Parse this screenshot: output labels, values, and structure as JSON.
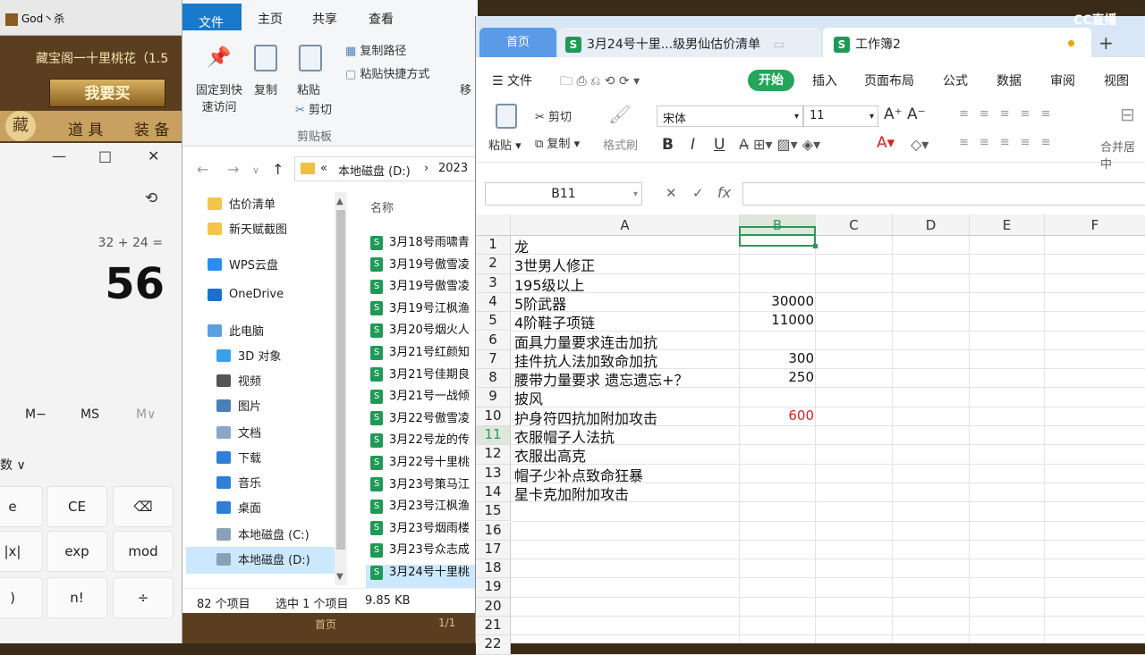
{
  "game": {
    "window_title": "God丶杀",
    "banner": "藏宝阁一十里桃花（1.5",
    "buy_label": "我要买",
    "seal": "藏",
    "tab1": "道 具",
    "tab2": "装 备"
  },
  "calculator": {
    "minimize": "—",
    "maximize": "□",
    "close": "✕",
    "history_icon": "history-icon",
    "expression": "32 + 24 =",
    "result": "56",
    "mem_minus": "M−",
    "mem_store": "MS",
    "mem_list": "M∨",
    "degree_fragment": "数 ∨",
    "rows": [
      [
        "e",
        "CE",
        "⌫"
      ],
      [
        "|x|",
        "exp",
        "mod"
      ],
      [
        ")",
        "n!",
        "÷"
      ]
    ]
  },
  "explorer": {
    "tabs": [
      "文件",
      "主页",
      "共享",
      "查看"
    ],
    "ribbon": {
      "pin": "固定到快\n速访问",
      "copy": "复制",
      "paste": "粘贴",
      "copy_path": "复制路径",
      "paste_shortcut": "粘贴快捷方式",
      "cut": "剪切",
      "group": "剪贴板",
      "move_fragment": "移"
    },
    "address": {
      "prefix": "«",
      "drive": "本地磁盘 (D:)",
      "sep": "›",
      "folder_fragment": "2023"
    },
    "nav": [
      {
        "label": "估价清单",
        "color": "#f3c54c"
      },
      {
        "label": "新天赋截图",
        "color": "#f3c54c"
      },
      {
        "label": "WPS云盘",
        "color": "#2b8cf0"
      },
      {
        "label": "OneDrive",
        "color": "#1f6fd0"
      },
      {
        "label": "此电脑",
        "color": "#5aa0e0"
      },
      {
        "label": "3D 对象",
        "color": "#3aa0e8"
      },
      {
        "label": "视频",
        "color": "#555555"
      },
      {
        "label": "图片",
        "color": "#4a7fb8"
      },
      {
        "label": "文档",
        "color": "#8aa6c8"
      },
      {
        "label": "下载",
        "color": "#2d7fd8"
      },
      {
        "label": "音乐",
        "color": "#2d7fd8"
      },
      {
        "label": "桌面",
        "color": "#2d7fd8"
      },
      {
        "label": "本地磁盘 (C:)",
        "color": "#8aa0b8"
      },
      {
        "label": "本地磁盘 (D:)",
        "color": "#8aa0b8"
      }
    ],
    "column_name": "名称",
    "files": [
      "3月18号雨啸青",
      "3月19号傲雪凌",
      "3月19号傲雪凌",
      "3月19号江枫渔",
      "3月20号烟火人",
      "3月21号红颜知",
      "3月21号佳期良",
      "3月21号一战倾",
      "3月22号傲雪凌",
      "3月22号龙的传",
      "3月22号十里桃",
      "3月23号策马江",
      "3月23号江枫渔",
      "3月23号烟雨楼",
      "3月23号众志成",
      "3月24号十里桃"
    ],
    "status": {
      "count": "82 个项目",
      "selected": "选中 1 个项目",
      "size": "9.85 KB"
    },
    "bottom_strip": {
      "home": "首页",
      "page": "1/1"
    }
  },
  "wps": {
    "home_tab": "首页",
    "tab1": "3月24号十里...级男仙估价清单",
    "tab2": "工作簿2",
    "brand": "CC直播",
    "menu": [
      "文件",
      "开始",
      "插入",
      "页面布局",
      "公式",
      "数据",
      "审阅",
      "视图"
    ],
    "toolbar": {
      "paste": "粘贴",
      "cut": "剪切",
      "copy": "复制",
      "format_painter": "格式刷",
      "font": "宋体",
      "size": "11",
      "bold": "B",
      "italic": "I",
      "underline": "U",
      "merge": "合并居中"
    },
    "namebox": "B11",
    "fx": "fx",
    "columns": [
      "A",
      "B",
      "C",
      "D",
      "E",
      "F"
    ],
    "rows": [
      {
        "n": "1",
        "a": "龙",
        "b": ""
      },
      {
        "n": "2",
        "a": "3世男人修正",
        "b": ""
      },
      {
        "n": "3",
        "a": "195级以上",
        "b": ""
      },
      {
        "n": "4",
        "a": "5阶武器",
        "b": "30000"
      },
      {
        "n": "5",
        "a": "4阶鞋子项链",
        "b": "11000"
      },
      {
        "n": "6",
        "a": "面具力量要求连击加抗",
        "b": ""
      },
      {
        "n": "7",
        "a": "挂件抗人法加致命加抗",
        "b": "300"
      },
      {
        "n": "8",
        "a": "腰带力量要求 遗忘遗忘+？",
        "b": "250"
      },
      {
        "n": "9",
        "a": "披风",
        "b": ""
      },
      {
        "n": "10",
        "a": "护身符四抗加附加攻击",
        "b": "600",
        "red": true
      },
      {
        "n": "11",
        "a": "衣服帽子人法抗",
        "b": ""
      },
      {
        "n": "12",
        "a": "衣服出高克",
        "b": ""
      },
      {
        "n": "13",
        "a": "帽子少补点致命狂暴",
        "b": ""
      },
      {
        "n": "14",
        "a": "星卡克加附加攻击",
        "b": ""
      },
      {
        "n": "15",
        "a": "",
        "b": ""
      },
      {
        "n": "16",
        "a": "",
        "b": ""
      },
      {
        "n": "17",
        "a": "",
        "b": ""
      },
      {
        "n": "18",
        "a": "",
        "b": ""
      },
      {
        "n": "19",
        "a": "",
        "b": ""
      },
      {
        "n": "20",
        "a": "",
        "b": ""
      },
      {
        "n": "21",
        "a": "",
        "b": ""
      },
      {
        "n": "22",
        "a": "",
        "b": ""
      }
    ],
    "colors": {
      "accent": "#25a55a",
      "red_value": "#e02020",
      "selected_col": "#2a9a55"
    }
  }
}
